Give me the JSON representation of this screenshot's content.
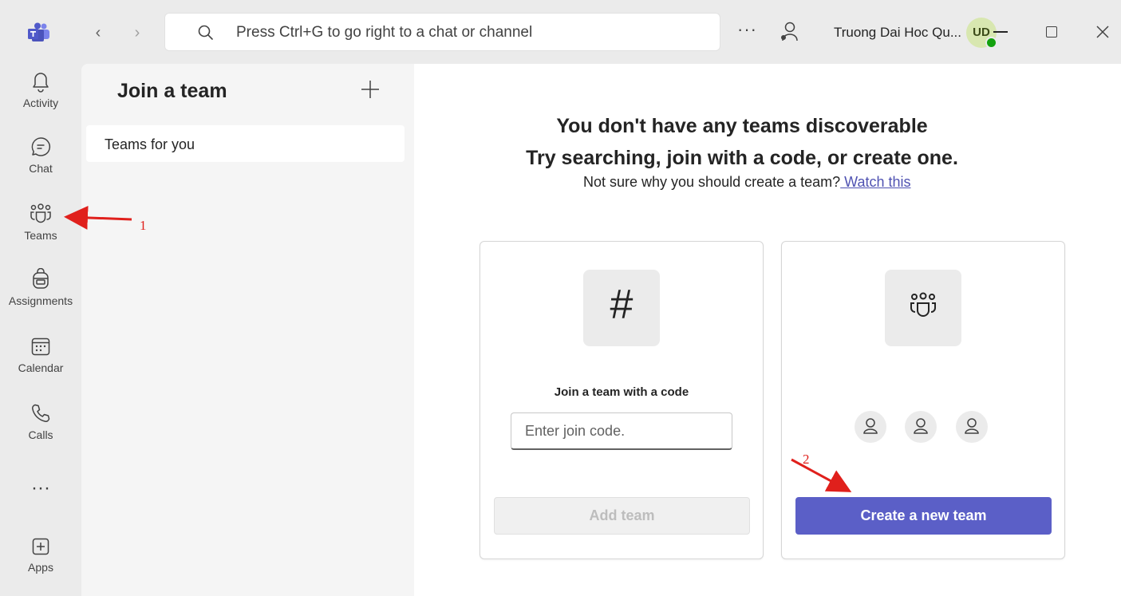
{
  "titlebar": {
    "search_placeholder": "Press Ctrl+G to go right to a chat or channel",
    "more_label": "···",
    "org_name": "Truong Dai Hoc Qu...",
    "avatar_initials": "UD"
  },
  "rail": {
    "items": [
      {
        "label": "Activity",
        "icon": "bell-icon"
      },
      {
        "label": "Chat",
        "icon": "chat-icon"
      },
      {
        "label": "Teams",
        "icon": "teams-icon"
      },
      {
        "label": "Assignments",
        "icon": "backpack-icon"
      },
      {
        "label": "Calendar",
        "icon": "calendar-icon"
      },
      {
        "label": "Calls",
        "icon": "phone-icon"
      },
      {
        "label": "",
        "icon": "more-icon"
      },
      {
        "label": "Apps",
        "icon": "add-app-icon"
      }
    ],
    "more_glyph": "···"
  },
  "list_pane": {
    "title": "Join a team",
    "items": [
      {
        "label": "Teams for you"
      }
    ]
  },
  "main": {
    "headline_1": "You don't have any teams discoverable",
    "headline_2": "Try searching, join with a code, or create one.",
    "subtext": "Not sure why you should create a team?",
    "watch_link": " Watch this",
    "join_card": {
      "icon_glyph": "#",
      "heading": "Join a team with a code",
      "input_placeholder": "Enter join code.",
      "button_label": "Add team"
    },
    "create_card": {
      "button_label": "Create a new team"
    }
  },
  "annotations": {
    "marker_1": "1",
    "marker_2": "2",
    "color": "#e0201c"
  },
  "colors": {
    "accent": "#5b5fc7",
    "link": "#4f52b2",
    "status_available": "#13a10e"
  }
}
